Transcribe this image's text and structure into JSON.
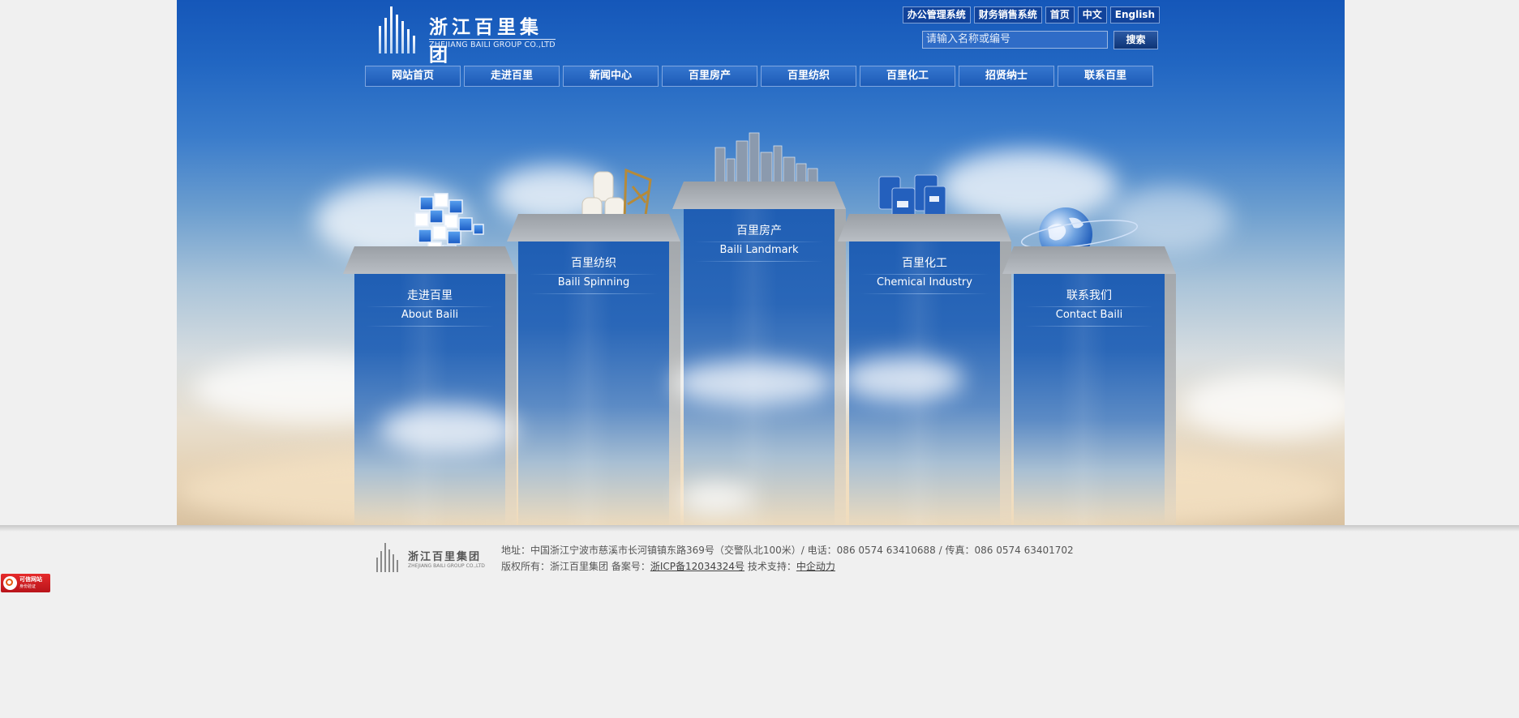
{
  "header": {
    "logo_cn": "浙江百里集团",
    "logo_en": "ZHEJIANG BAILI GROUP CO.,LTD",
    "top_links": [
      "办公管理系统",
      "财务销售系统",
      "首页",
      "中文",
      "English"
    ],
    "search": {
      "placeholder": "请输入名称或编号",
      "button": "搜索"
    }
  },
  "nav": [
    "网站首页",
    "走进百里",
    "新闻中心",
    "百里房产",
    "百里纺织",
    "百里化工",
    "招贤纳士",
    "联系百里"
  ],
  "pillars": [
    {
      "cn": "走进百里",
      "en": "About Baili",
      "icon": "rubiks-cube-icon"
    },
    {
      "cn": "百里纺织",
      "en": "Baili Spinning",
      "icon": "yarn-spools-icon"
    },
    {
      "cn": "百里房产",
      "en": "Baili Landmark",
      "icon": "skyscrapers-icon"
    },
    {
      "cn": "百里化工",
      "en": "Chemical Industry",
      "icon": "chemical-barrels-icon"
    },
    {
      "cn": "联系我们",
      "en": "Contact Baili",
      "icon": "globe-icon"
    }
  ],
  "footer": {
    "logo_cn": "浙江百里集团",
    "logo_en": "ZHEJIANG BAILI GROUP CO.,LTD",
    "address": "地址：中国浙江宁波市慈溪市长河镇镇东路369号（交警队北100米）/ 电话：086 0574 63410688 / 传真：086 0574 63401702",
    "copyright_prefix": "版权所有：浙江百里集团 备案号：",
    "icp": "浙ICP备12034324号",
    "tech_prefix": " 技术支持：",
    "tech": "中企动力"
  },
  "badge": {
    "line1": "可信网站",
    "line2": "身份验证"
  },
  "colors": {
    "primary": "#1557b9",
    "nav": "#2a68c2",
    "dark_button": "#11439b",
    "badge_red": "#d42020"
  }
}
